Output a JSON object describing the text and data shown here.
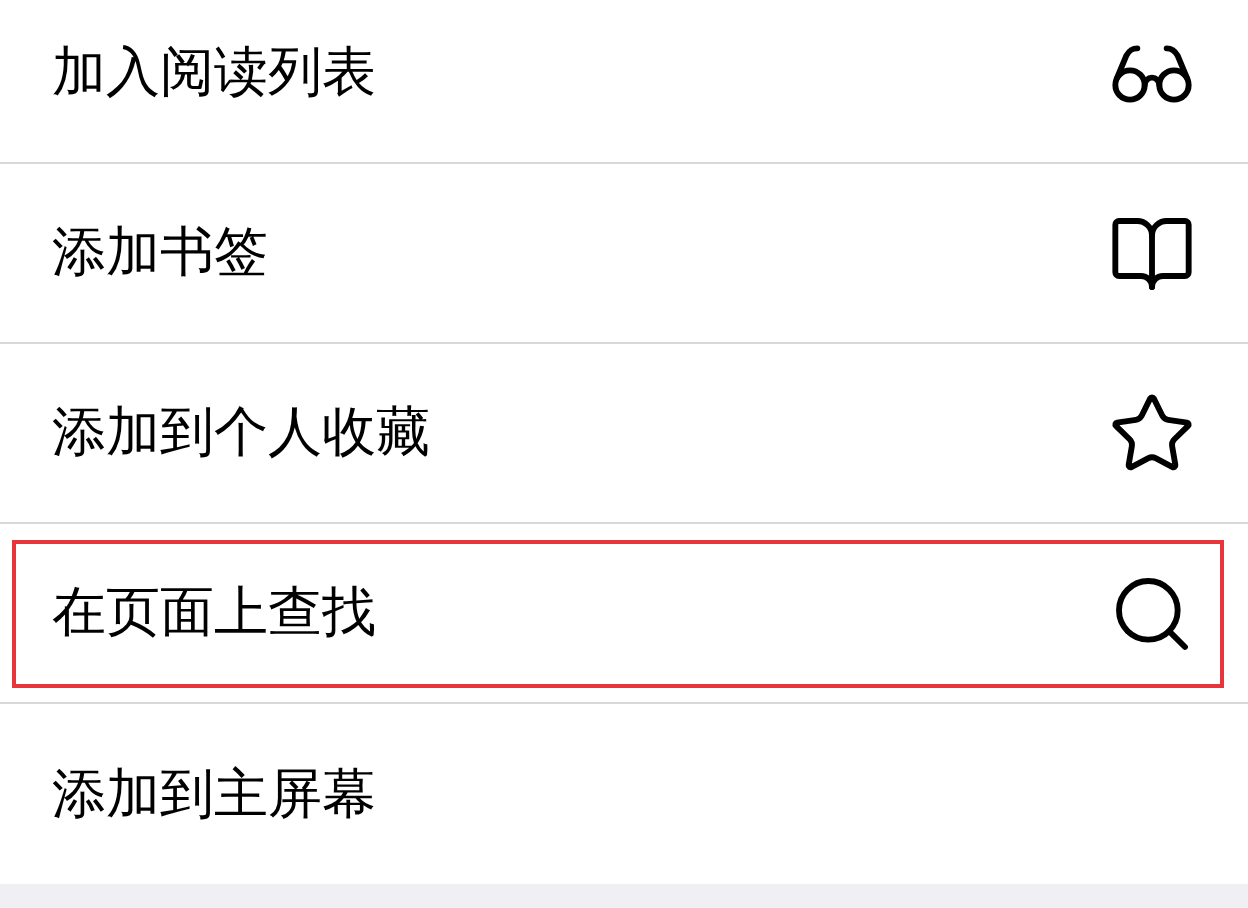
{
  "menu": {
    "items": [
      {
        "label": "加入阅读列表",
        "kind": "reading-list",
        "highlighted": false
      },
      {
        "label": "添加书签",
        "kind": "bookmark",
        "highlighted": false
      },
      {
        "label": "添加到个人收藏",
        "kind": "favorite",
        "highlighted": false
      },
      {
        "label": "在页面上查找",
        "kind": "find",
        "highlighted": true
      },
      {
        "label": "添加到主屏幕",
        "kind": "home-screen",
        "highlighted": false
      }
    ]
  }
}
